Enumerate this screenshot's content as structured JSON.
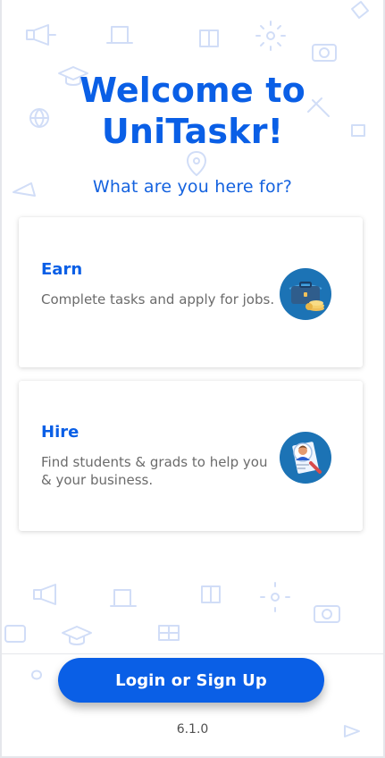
{
  "title": "Welcome to UniTaskr!",
  "subtitle": "What are you here for?",
  "cards": [
    {
      "label": "Earn",
      "description": "Complete tasks and apply for jobs.",
      "icon": "briefcase-coins-icon"
    },
    {
      "label": "Hire",
      "description": "Find students & grads to help you & your business.",
      "icon": "student-profile-icon"
    }
  ],
  "login_button": "Login or Sign Up",
  "version": "6.1.0",
  "colors": {
    "primary": "#0a5fe6",
    "background": "#ffffff"
  }
}
